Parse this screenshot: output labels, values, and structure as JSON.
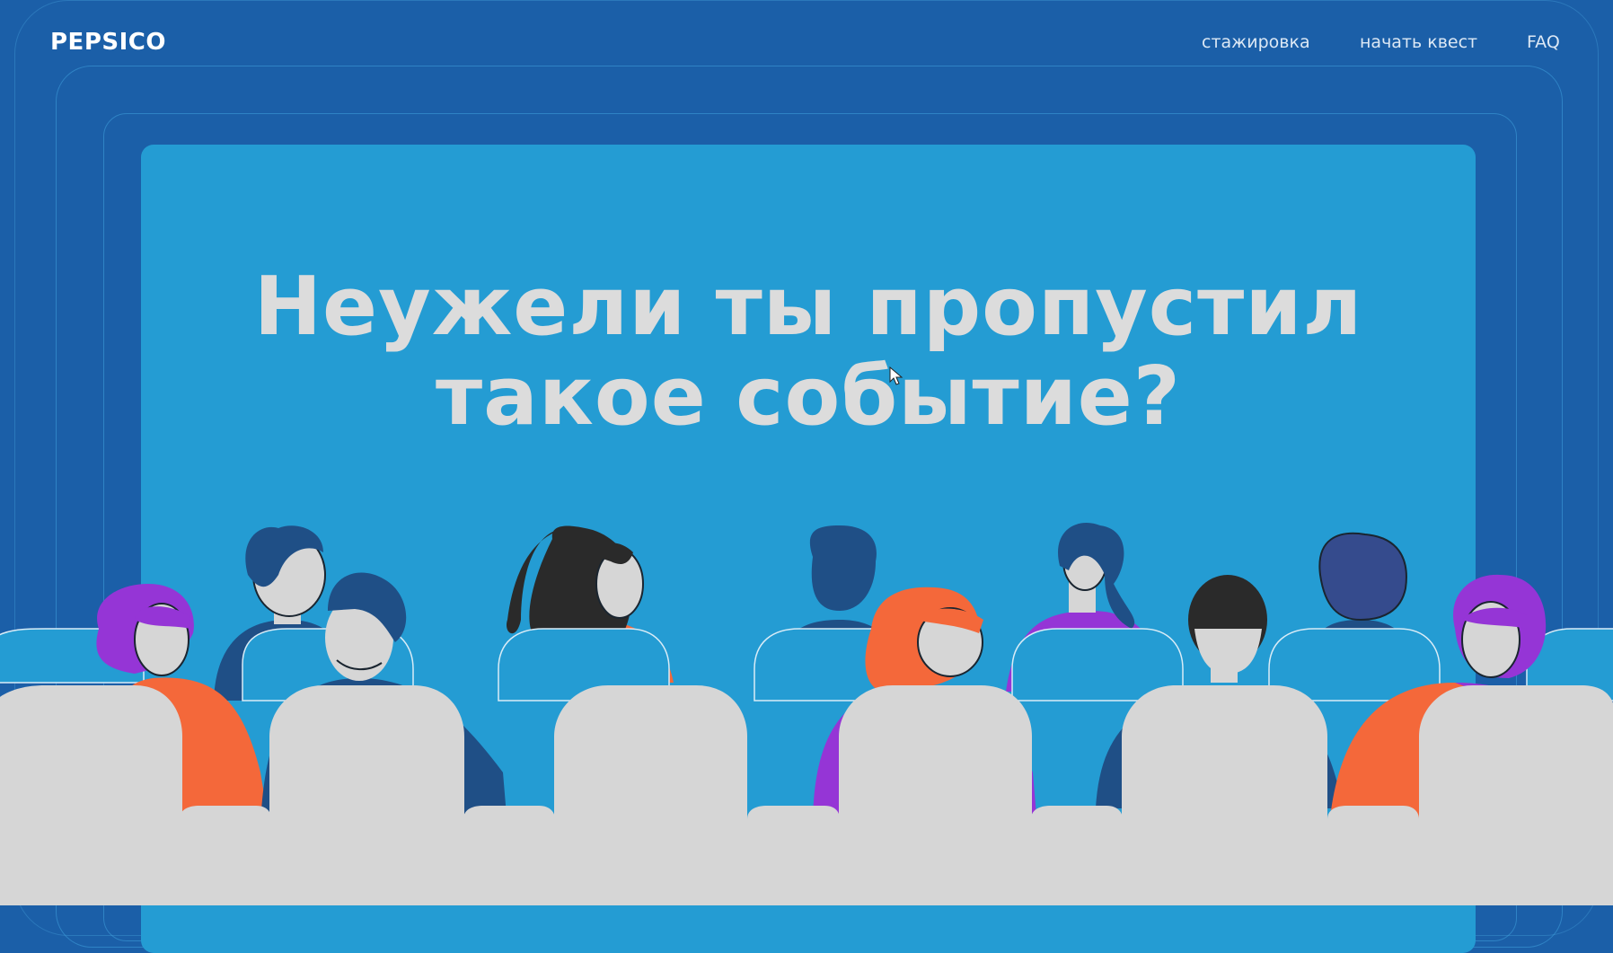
{
  "header": {
    "logo": "PEPSICO",
    "nav": [
      {
        "label": "стажировка"
      },
      {
        "label": "начать квест"
      },
      {
        "label": "FAQ"
      }
    ]
  },
  "hero": {
    "headline_line1": "Неужели ты пропустил",
    "headline_line2": "такое событие?"
  },
  "colors": {
    "background": "#1b5fa8",
    "screen": "#249cd3",
    "headline": "#dcdcdc",
    "seats": "#d6d6d6",
    "accent_orange": "#f4683a",
    "accent_purple": "#9535d6"
  }
}
